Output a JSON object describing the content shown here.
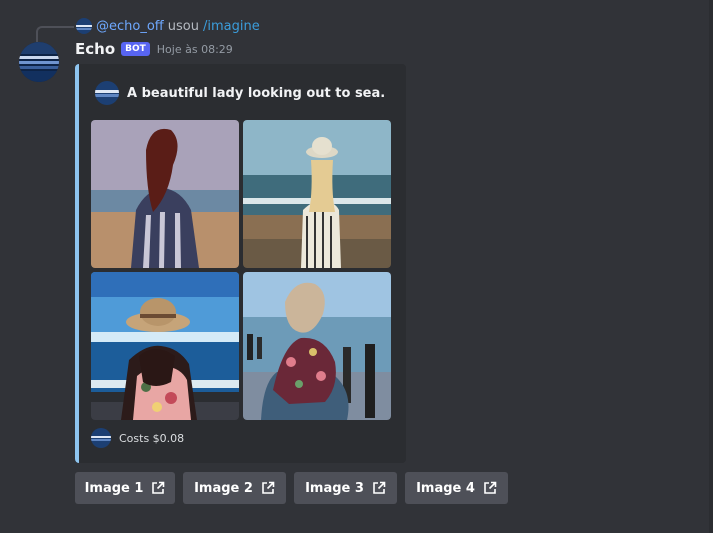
{
  "reply": {
    "mention": "@echo_off",
    "used_text": "usou",
    "command": "/imagine"
  },
  "message": {
    "username": "Echo",
    "bot_tag": "BOT",
    "timestamp": "Hoje às 08:29"
  },
  "embed": {
    "title": "A beautiful lady looking out to sea.",
    "footer": "Costs $0.08",
    "accent_color": "#8ec5f0"
  },
  "buttons": [
    {
      "label": "Image 1"
    },
    {
      "label": "Image 2"
    },
    {
      "label": "Image 3"
    },
    {
      "label": "Image 4"
    }
  ],
  "colors": {
    "background": "#313338",
    "embed_bg": "#2b2d31",
    "button_bg": "#4e5058",
    "bot_tag": "#5865f2"
  }
}
